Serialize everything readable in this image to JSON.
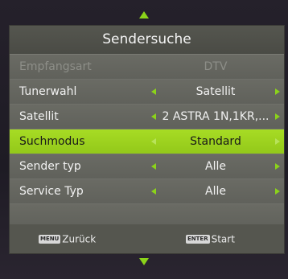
{
  "title": "Sendersuche",
  "rows": [
    {
      "label": "Empfangsart",
      "value": "DTV"
    },
    {
      "label": "Tunerwahl",
      "value": "Satellit"
    },
    {
      "label": "Satellit",
      "value": "2 ASTRA 1N,1KR,..."
    },
    {
      "label": "Suchmodus",
      "value": "Standard"
    },
    {
      "label": "Sender typ",
      "value": "Alle"
    },
    {
      "label": "Service Typ",
      "value": "Alle"
    }
  ],
  "footer": {
    "back_key": "MENU",
    "back_label": "Zurück",
    "start_key": "ENTER",
    "start_label": "Start"
  },
  "colors": {
    "accent": "#8bd31a",
    "selected_row": "#a7dc24",
    "panel": "#5e5f59"
  }
}
